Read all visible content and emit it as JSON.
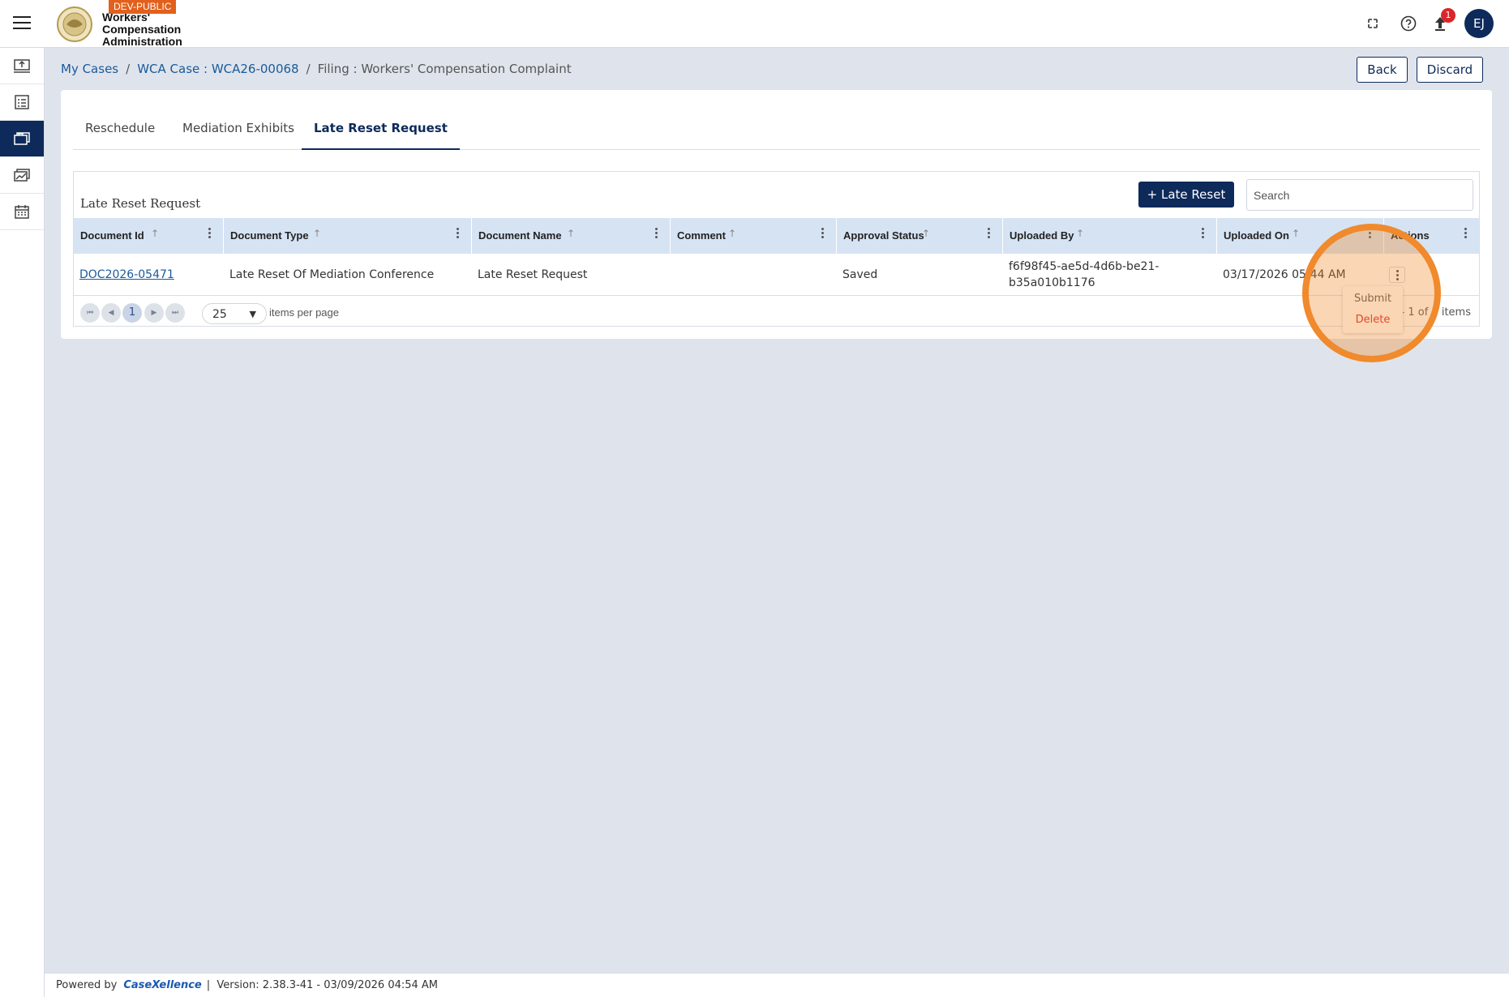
{
  "header": {
    "env_badge": "DEV-PUBLIC",
    "org_name_lines": [
      "Workers'",
      "Compensation",
      "Administration"
    ],
    "notification_count": "1",
    "user_initials": "EJ"
  },
  "breadcrumb": {
    "items": [
      "My Cases",
      "WCA Case : WCA26-00068",
      "Filing : Workers' Compensation Complaint"
    ],
    "separator": "/"
  },
  "page_actions": {
    "back_label": "Back",
    "discard_label": "Discard"
  },
  "tabs": [
    {
      "label": "Reschedule",
      "active": false
    },
    {
      "label": "Mediation Exhibits",
      "active": false
    },
    {
      "label": "Late Reset Request",
      "active": true
    }
  ],
  "grid": {
    "title": "Late Reset Request",
    "add_button_label": "+ Late Reset",
    "search_placeholder": "Search",
    "columns": [
      "Document Id",
      "Document Type",
      "Document Name",
      "Comment",
      "Approval Status",
      "Uploaded By",
      "Uploaded On",
      "Actions"
    ],
    "rows": [
      {
        "document_id": "DOC2026-05471",
        "document_type": "Late Reset Of Mediation Conference",
        "document_name": "Late Reset Request",
        "comment": "",
        "approval_status": "Saved",
        "uploaded_by": "f6f98f45-ae5d-4d6b-be21-b35a010b1176",
        "uploaded_on": "03/17/2026 05:44 AM"
      }
    ],
    "pager": {
      "current_page": "1",
      "per_page": "25",
      "per_page_label": "items per page",
      "items_count": "1 - 1 of 1 items"
    },
    "row_actions_menu": [
      "Submit",
      "Delete"
    ]
  },
  "footer": {
    "powered_by": "Powered by",
    "brand": "CaseXellence",
    "separator": "|",
    "version": "Version: 2.38.3-41 - 03/09/2026 04:54 AM"
  },
  "colors": {
    "primary": "#0d2a5a",
    "link": "#1a5a9a",
    "badge": "#e2601c",
    "highlight": "#f08a2c",
    "notification": "#d9262a",
    "grid_header": "#d6e3f3"
  }
}
